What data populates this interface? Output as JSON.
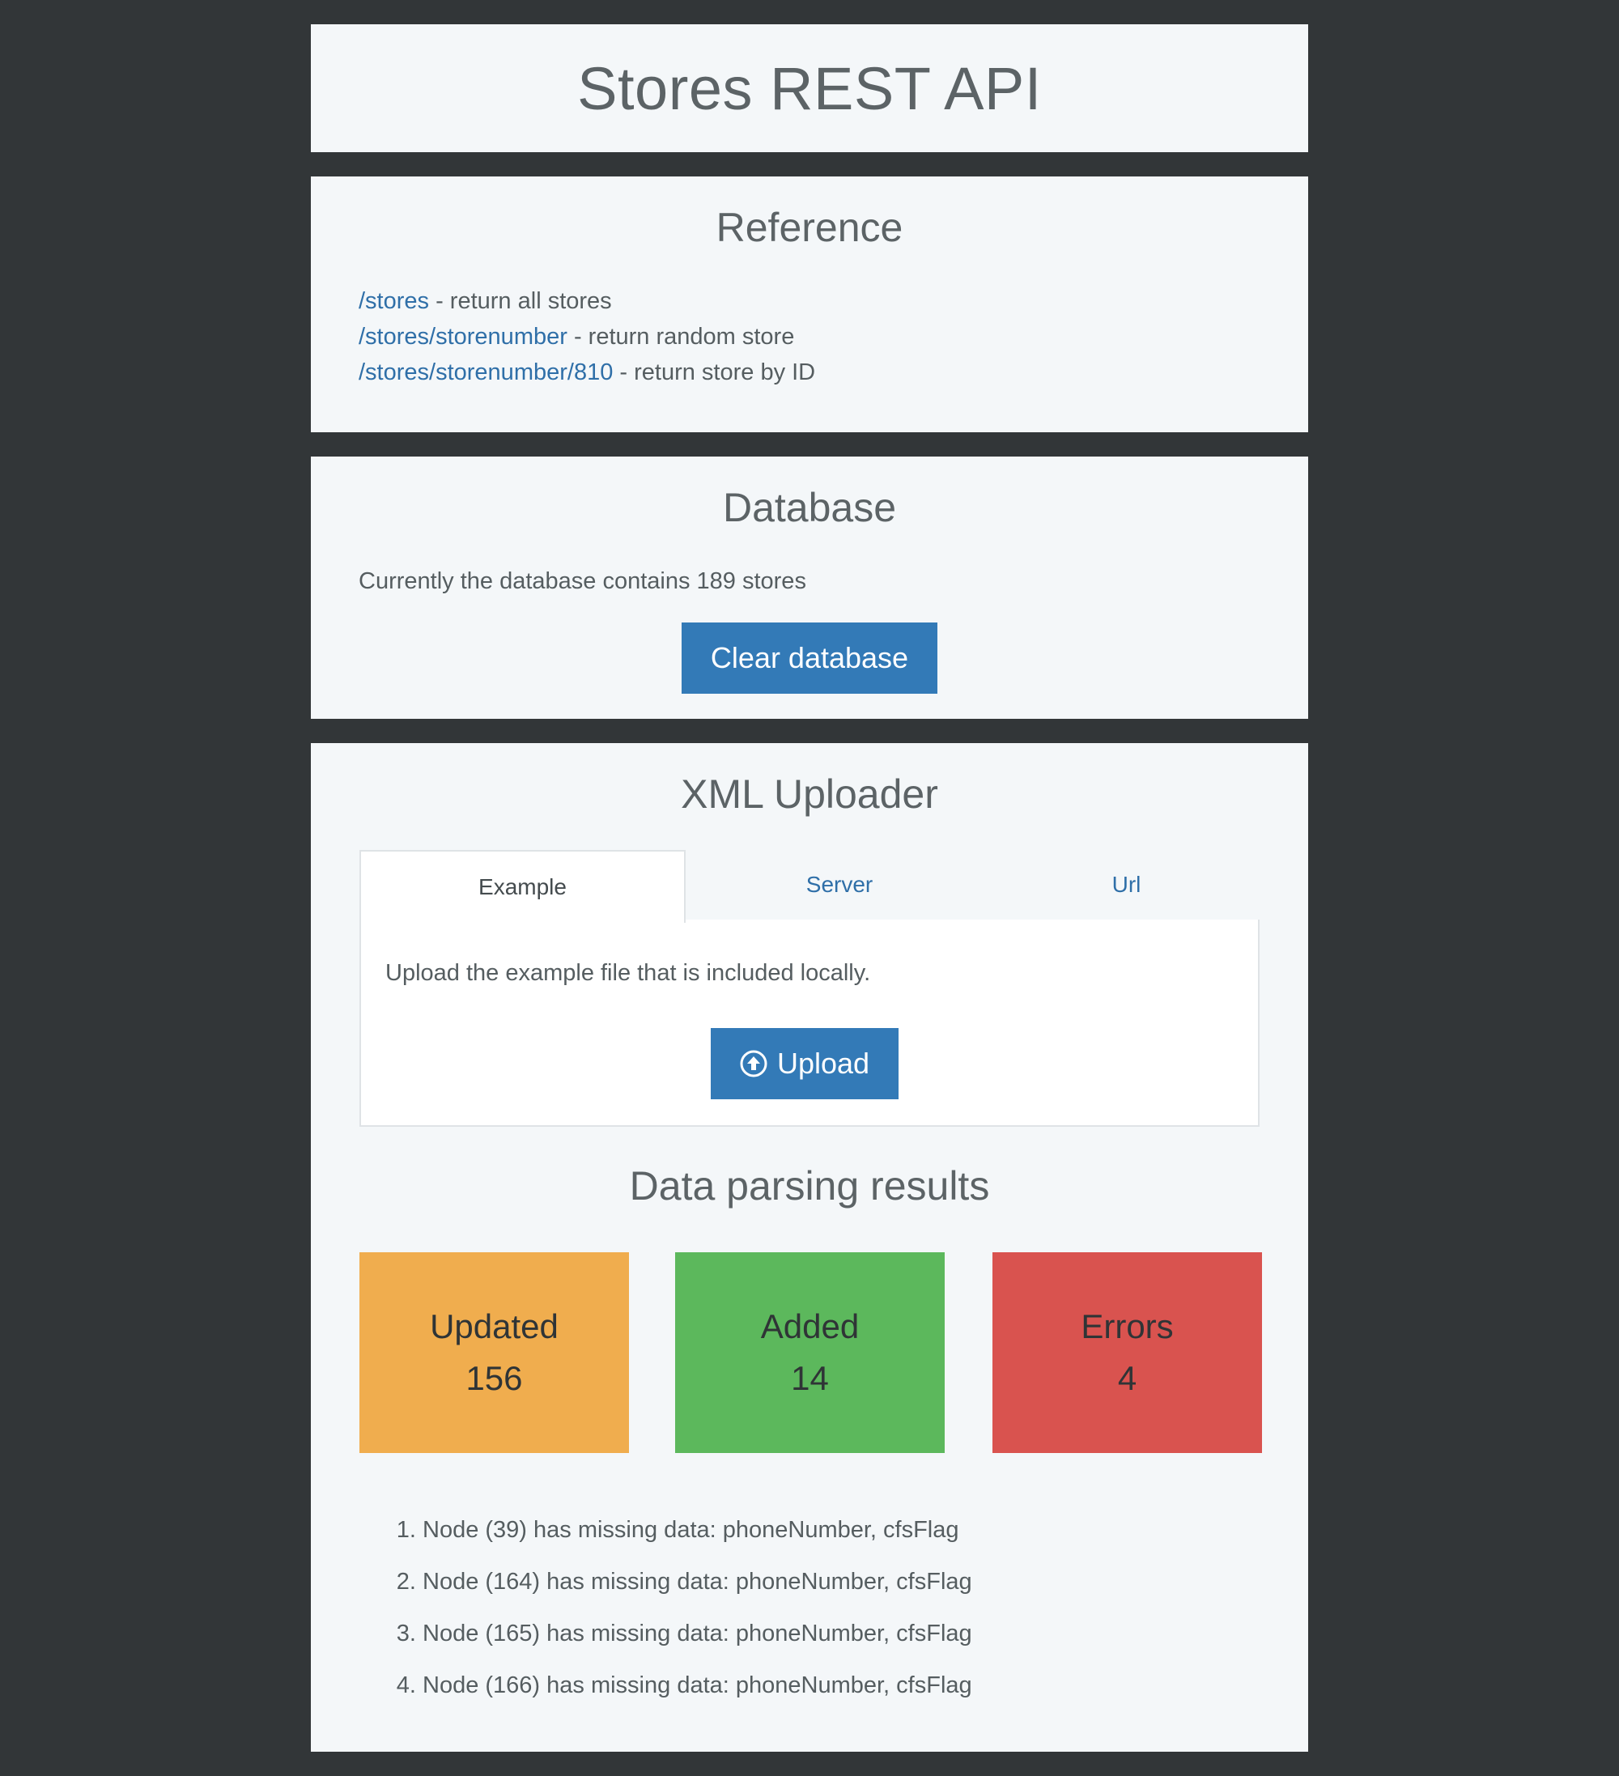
{
  "page": {
    "title": "Stores REST API"
  },
  "reference": {
    "title": "Reference",
    "items": [
      {
        "path": "/stores",
        "desc": " - return all stores"
      },
      {
        "path": "/stores/storenumber",
        "desc": " - return random store"
      },
      {
        "path": "/stores/storenumber/810",
        "desc": " - return store by ID"
      }
    ]
  },
  "database": {
    "title": "Database",
    "text": "Currently the database contains 189 stores",
    "clear_label": "Clear database"
  },
  "uploader": {
    "title": "XML Uploader",
    "tabs": [
      {
        "label": "Example",
        "active": true
      },
      {
        "label": "Server",
        "active": false
      },
      {
        "label": "Url",
        "active": false
      }
    ],
    "tab_desc": "Upload the example file that is included locally.",
    "upload_label": "Upload",
    "upload_icon": "circle-arrow-up-icon"
  },
  "results": {
    "title": "Data parsing results",
    "stats": [
      {
        "label": "Updated",
        "value": "156",
        "color": "#f0ad4e"
      },
      {
        "label": "Added",
        "value": "14",
        "color": "#5cb85c"
      },
      {
        "label": "Errors",
        "value": "4",
        "color": "#d9534f"
      }
    ],
    "errors": [
      "Node (39) has missing data: phoneNumber, cfsFlag",
      "Node (164) has missing data: phoneNumber, cfsFlag",
      "Node (165) has missing data: phoneNumber, cfsFlag",
      "Node (166) has missing data: phoneNumber, cfsFlag"
    ]
  }
}
